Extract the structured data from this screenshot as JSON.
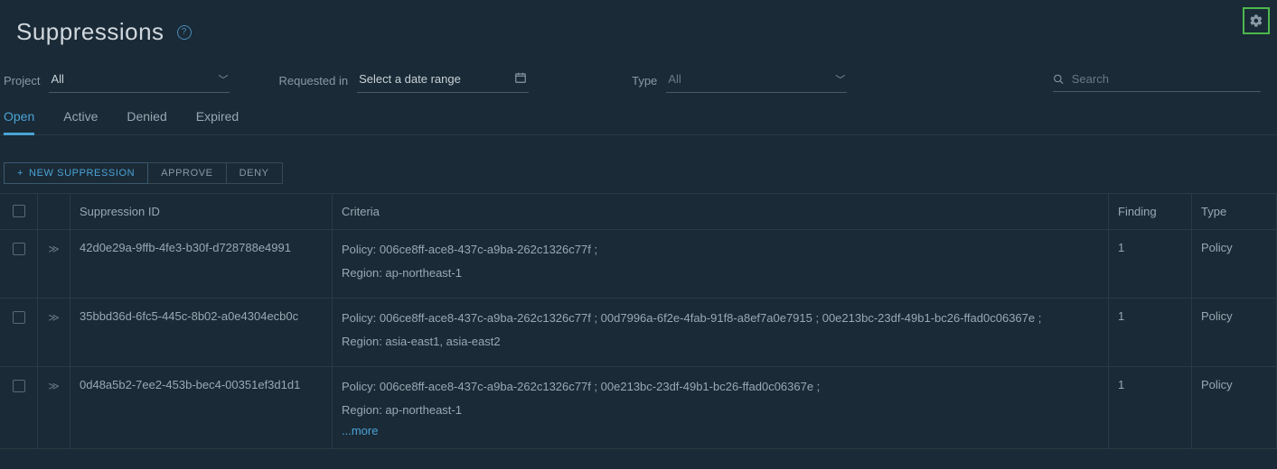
{
  "page_title": "Suppressions",
  "filters": {
    "project": {
      "label": "Project",
      "value": "All"
    },
    "requested_in": {
      "label": "Requested in",
      "placeholder": "Select a date range"
    },
    "type": {
      "label": "Type",
      "value": "All"
    }
  },
  "search": {
    "placeholder": "Search"
  },
  "tabs": [
    {
      "label": "Open",
      "active": true
    },
    {
      "label": "Active",
      "active": false
    },
    {
      "label": "Denied",
      "active": false
    },
    {
      "label": "Expired",
      "active": false
    }
  ],
  "actions": {
    "new": "NEW SUPPRESSION",
    "approve": "APPROVE",
    "deny": "DENY"
  },
  "columns": {
    "suppression_id": "Suppression ID",
    "criteria": "Criteria",
    "finding": "Finding",
    "type": "Type"
  },
  "rows": [
    {
      "id": "42d0e29a-9ffb-4fe3-b30f-d728788e4991",
      "criteria_policy": "Policy: 006ce8ff-ace8-437c-a9ba-262c1326c77f ;",
      "criteria_region": "Region: ap-northeast-1",
      "finding": "1",
      "type": "Policy",
      "more": ""
    },
    {
      "id": "35bbd36d-6fc5-445c-8b02-a0e4304ecb0c",
      "criteria_policy": "Policy: 006ce8ff-ace8-437c-a9ba-262c1326c77f ; 00d7996a-6f2e-4fab-91f8-a8ef7a0e7915 ; 00e213bc-23df-49b1-bc26-ffad0c06367e ;",
      "criteria_region": "Region: asia-east1, asia-east2",
      "finding": "1",
      "type": "Policy",
      "more": ""
    },
    {
      "id": "0d48a5b2-7ee2-453b-bec4-00351ef3d1d1",
      "criteria_policy": "Policy: 006ce8ff-ace8-437c-a9ba-262c1326c77f ; 00e213bc-23df-49b1-bc26-ffad0c06367e ;",
      "criteria_region": "Region: ap-northeast-1",
      "finding": "1",
      "type": "Policy",
      "more": "...more"
    }
  ]
}
